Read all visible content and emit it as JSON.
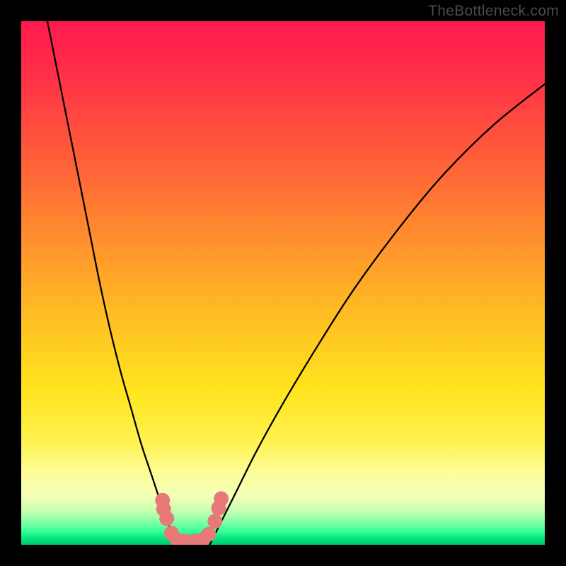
{
  "watermark": "TheBottleneck.com",
  "chart_data": {
    "type": "line",
    "title": "",
    "xlabel": "",
    "ylabel": "",
    "x_range": [
      0,
      100
    ],
    "y_range": [
      0,
      100
    ],
    "series": [
      {
        "name": "left-curve",
        "x": [
          5,
          7,
          9,
          11,
          13,
          15,
          17,
          19,
          21,
          23,
          25,
          27,
          28.5,
          30
        ],
        "y": [
          100,
          90,
          80,
          70,
          60,
          50,
          41,
          33,
          26,
          19,
          13,
          7,
          3,
          0
        ]
      },
      {
        "name": "right-curve",
        "x": [
          36,
          38,
          41,
          45,
          50,
          56,
          63,
          71,
          80,
          90,
          100
        ],
        "y": [
          0,
          4,
          10,
          18,
          27,
          37,
          48,
          59,
          70,
          80,
          88
        ]
      }
    ],
    "markers": {
      "name": "valley-markers",
      "color": "#e77a78",
      "points": [
        {
          "x": 27.0,
          "y": 8.5
        },
        {
          "x": 27.2,
          "y": 6.8
        },
        {
          "x": 27.8,
          "y": 5.0
        },
        {
          "x": 28.7,
          "y": 2.2
        },
        {
          "x": 29.8,
          "y": 0.9
        },
        {
          "x": 31.3,
          "y": 0.7
        },
        {
          "x": 33.0,
          "y": 0.7
        },
        {
          "x": 34.6,
          "y": 1.0
        },
        {
          "x": 35.8,
          "y": 2.0
        },
        {
          "x": 37.0,
          "y": 4.5
        },
        {
          "x": 37.7,
          "y": 7.0
        },
        {
          "x": 38.2,
          "y": 8.8
        }
      ]
    },
    "background_gradient": {
      "stops": [
        {
          "offset": 0.0,
          "color": "#ff1a4e"
        },
        {
          "offset": 0.1,
          "color": "#ff2f48"
        },
        {
          "offset": 0.25,
          "color": "#ff5a3a"
        },
        {
          "offset": 0.4,
          "color": "#ff8a2e"
        },
        {
          "offset": 0.55,
          "color": "#ffba24"
        },
        {
          "offset": 0.7,
          "color": "#ffe31d"
        },
        {
          "offset": 0.8,
          "color": "#fff24c"
        },
        {
          "offset": 0.86,
          "color": "#fdfd96"
        },
        {
          "offset": 0.905,
          "color": "#f6ffb8"
        },
        {
          "offset": 0.935,
          "color": "#c8ffb0"
        },
        {
          "offset": 0.958,
          "color": "#7dffa6"
        },
        {
          "offset": 0.975,
          "color": "#34ff98"
        },
        {
          "offset": 0.99,
          "color": "#00e07c"
        },
        {
          "offset": 1.0,
          "color": "#00c96b"
        }
      ]
    }
  }
}
